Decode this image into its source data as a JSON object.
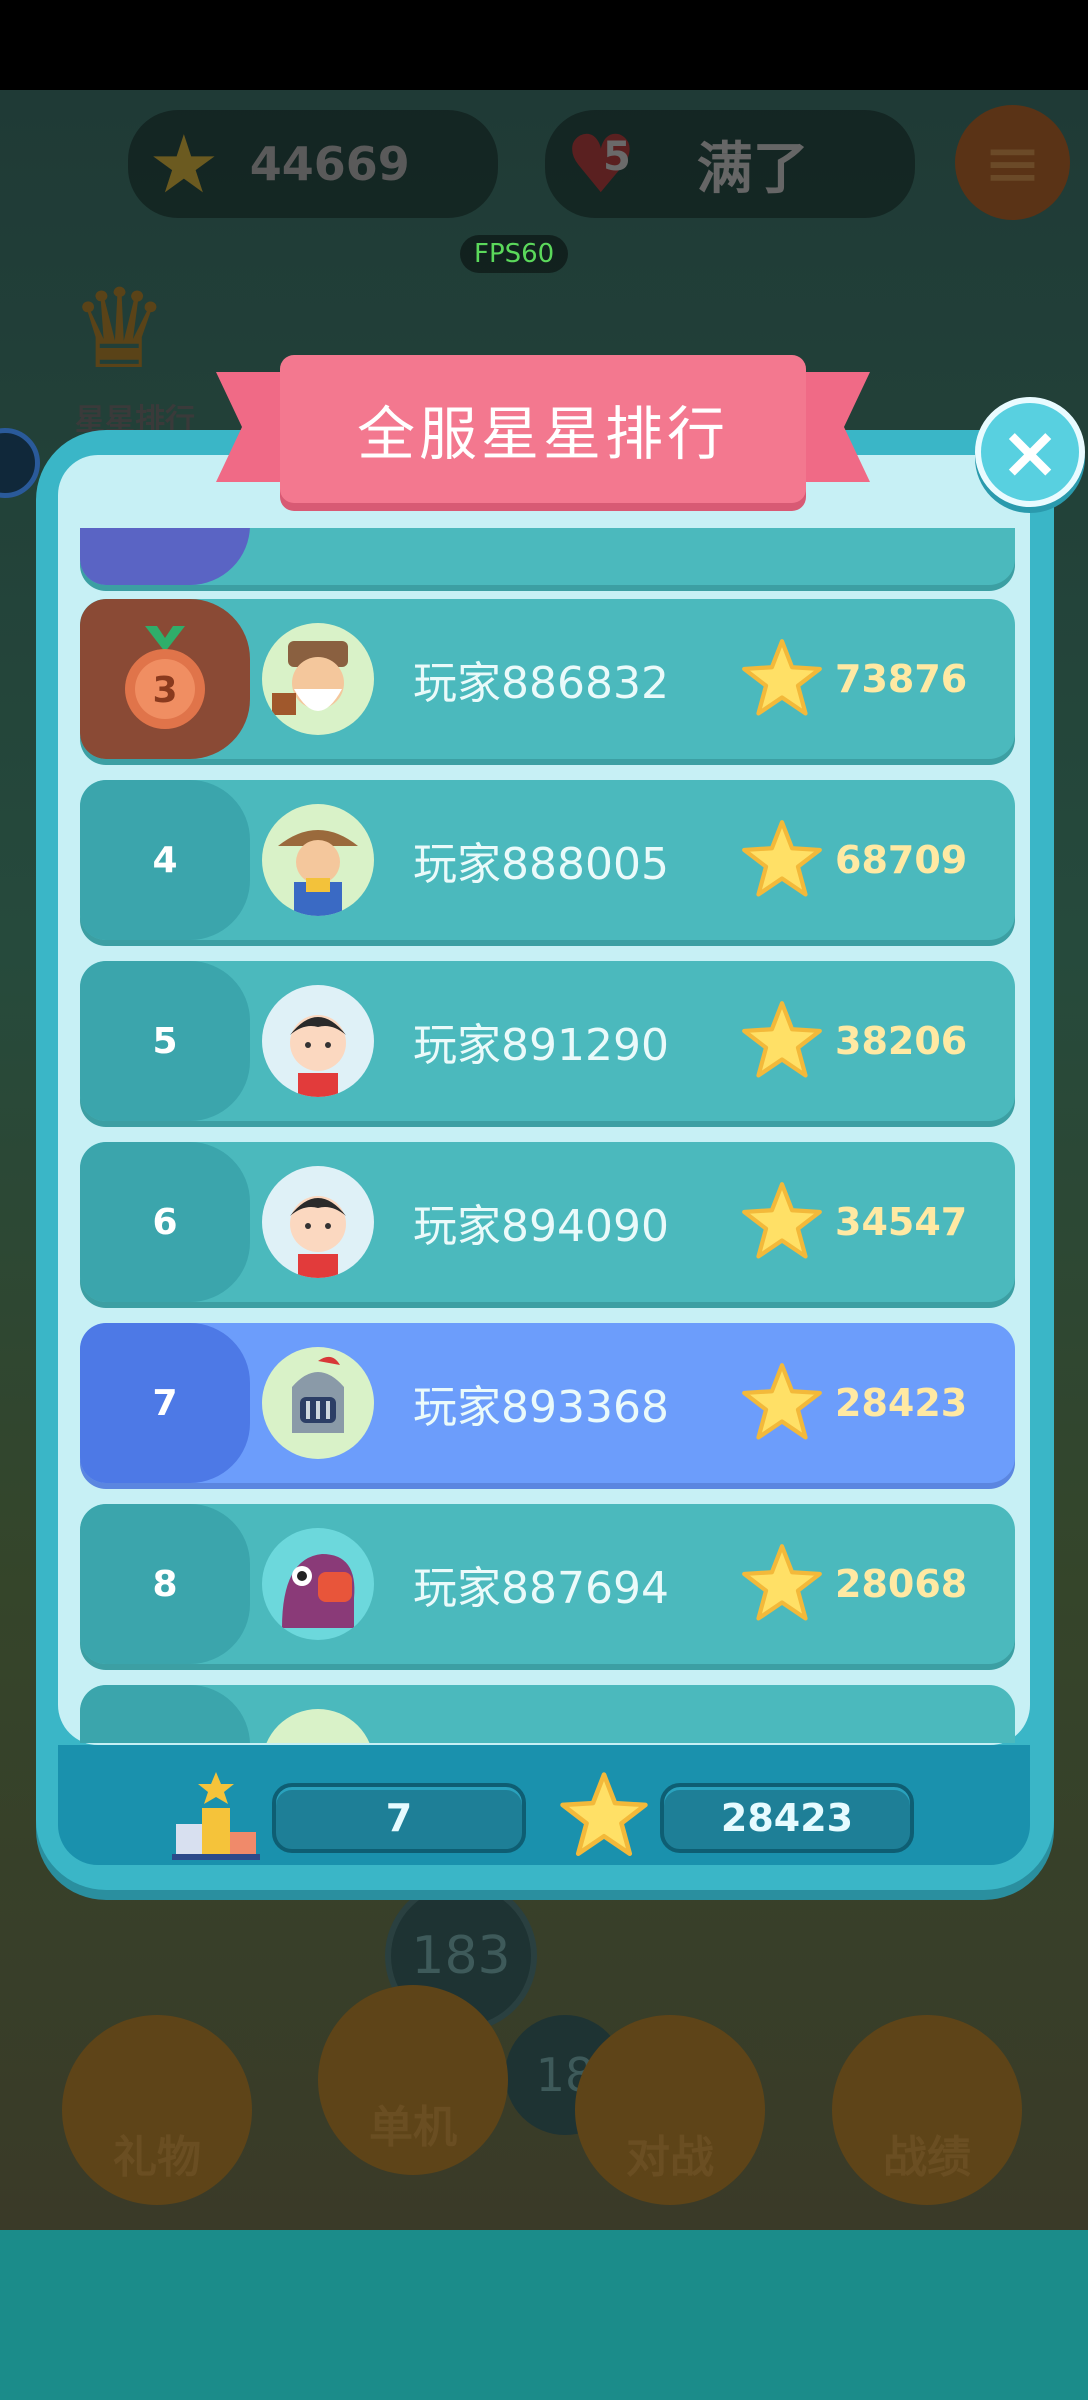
{
  "hud": {
    "stars": "44669",
    "hearts": "5",
    "hearts_status": "满了",
    "fps": "FPS60",
    "crown_label": "星星排行",
    "bg_number_1": "183",
    "bg_number_2": "18"
  },
  "bottom_menu": {
    "gift": "礼物",
    "single": "单机",
    "versus": "对战",
    "record": "战绩"
  },
  "modal": {
    "title": "全服星星排行",
    "close_icon": "×"
  },
  "rankings": [
    {
      "rank": "3",
      "name": "玩家886832",
      "score": "73876",
      "avatar": "old-farmer-avatar"
    },
    {
      "rank": "4",
      "name": "玩家888005",
      "score": "68709",
      "avatar": "farmer-pitchfork-avatar"
    },
    {
      "rank": "5",
      "name": "玩家891290",
      "score": "38206",
      "avatar": "boy-avatar"
    },
    {
      "rank": "6",
      "name": "玩家894090",
      "score": "34547",
      "avatar": "boy-avatar"
    },
    {
      "rank": "7",
      "name": "玩家893368",
      "score": "28423",
      "avatar": "knight-avatar"
    },
    {
      "rank": "8",
      "name": "玩家887694",
      "score": "28068",
      "avatar": "bird-avatar"
    }
  ],
  "my_rank": {
    "rank": "7",
    "score": "28423"
  },
  "colors": {
    "row": "#4bb9bd",
    "highlight_row": "#6c9dfb",
    "bronze": "#8a4a35",
    "ribbon": "#f3788f",
    "score_text": "#ffe9a3"
  }
}
